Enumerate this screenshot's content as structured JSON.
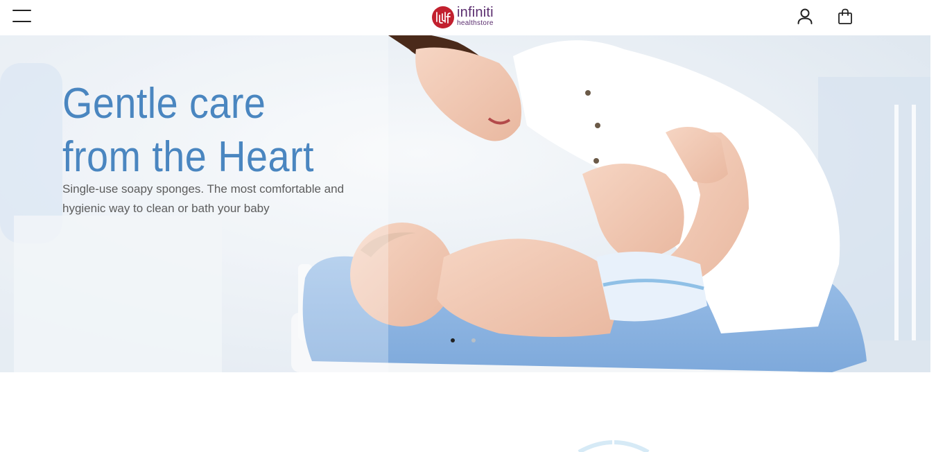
{
  "header": {
    "logo": {
      "name": "infiniti",
      "sub": "healthstore",
      "brand_color": "#c2202e",
      "text_color": "#5a2d6e"
    },
    "icons": {
      "menu": "hamburger-menu-icon",
      "account": "user-icon",
      "cart": "shopping-bag-icon"
    }
  },
  "hero": {
    "title_line1": "Gentle care",
    "title_line2": "from the Heart",
    "subtitle": "Single-use soapy sponges. The most comfortable and hygienic way to clean or bath your baby",
    "title_color": "#4a86c0",
    "slides": {
      "count": 2,
      "active": 1
    }
  }
}
